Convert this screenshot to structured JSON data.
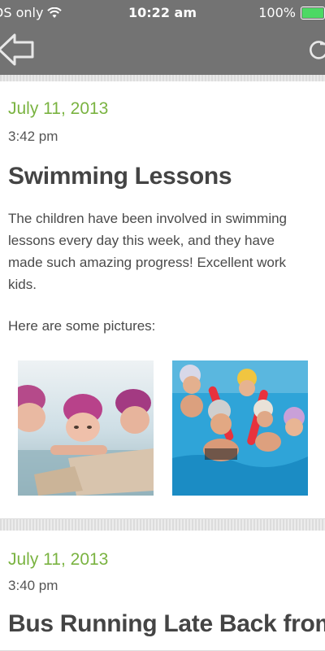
{
  "status_bar": {
    "carrier": "DS only",
    "time": "10:22 am",
    "battery": "100%",
    "battery_level": 1.0
  },
  "nav": {
    "back_icon": "back-arrow-icon",
    "refresh_icon": "refresh-icon"
  },
  "posts": [
    {
      "date": "July 11, 2013",
      "time": "3:42 pm",
      "title": "Swimming Lessons",
      "body": "The children have been involved in swimming lessons every day this week, and they have made such amazing progress! Excellent work kids.",
      "pictures_label": "Here are some pictures:"
    },
    {
      "date": "July 11, 2013",
      "time": "3:40 pm",
      "title": "Bus Running Late Back from"
    }
  ],
  "colors": {
    "bar": "#737373",
    "date_green": "#7ab341",
    "battery_green": "#4cd964"
  }
}
